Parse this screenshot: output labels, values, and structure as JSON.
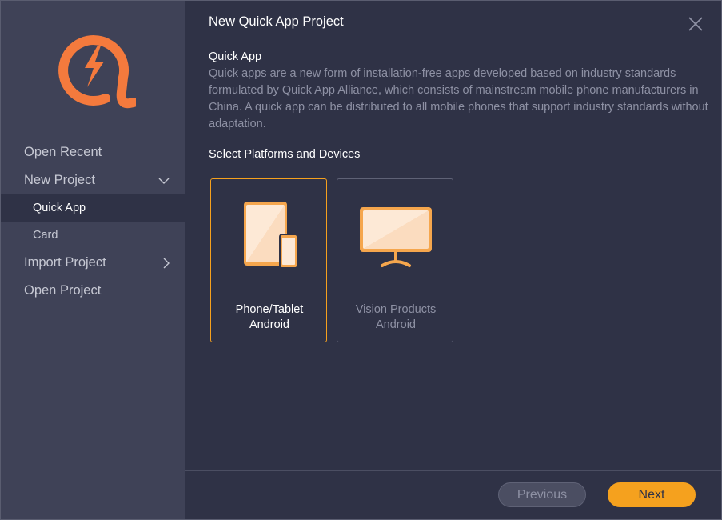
{
  "dialog": {
    "title": "New Quick App Project",
    "close_icon": "close-icon"
  },
  "sidebar": {
    "logo_icon": "quick-app-logo",
    "items": [
      {
        "label": "Open Recent"
      },
      {
        "label": "New Project",
        "expanded": true,
        "chevron": "chevron-down-icon"
      },
      {
        "label": "Quick App",
        "selected": true
      },
      {
        "label": "Card"
      },
      {
        "label": "Import Project",
        "expanded": false,
        "chevron": "chevron-right-icon"
      },
      {
        "label": "Open Project"
      }
    ]
  },
  "main": {
    "section_title": "Quick App",
    "description": "Quick apps are a new form of installation-free apps developed based on industry standards formulated by Quick App Alliance, which consists of mainstream mobile phone manufacturers in China. A quick app can be distributed to all mobile phones that support industry standards without adaptation.",
    "platforms_title": "Select Platforms and Devices",
    "platforms": [
      {
        "line1": "Phone/Tablet",
        "line2": "Android",
        "selected": true,
        "icon": "phone-tablet-icon"
      },
      {
        "line1": "Vision Products",
        "line2": "Android",
        "selected": false,
        "icon": "monitor-icon"
      }
    ]
  },
  "footer": {
    "previous_label": "Previous",
    "next_label": "Next"
  },
  "colors": {
    "accent": "#f5a11e",
    "logo": "#f47a3d",
    "background": "#2f3246",
    "sidebar": "#3f4257"
  }
}
